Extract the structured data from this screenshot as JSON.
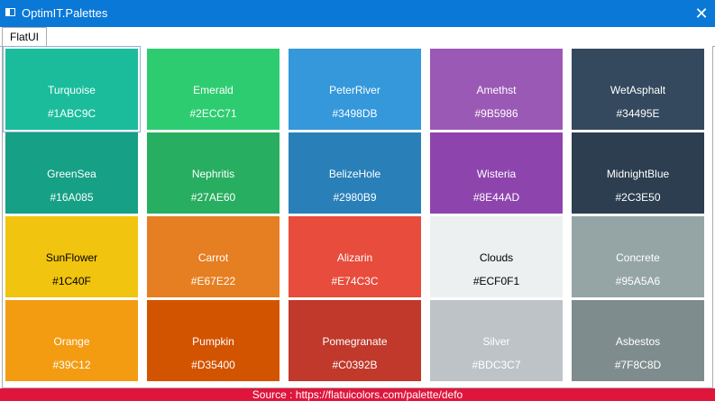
{
  "window": {
    "title": "OptimIT.Palettes",
    "close_glyph": "✕"
  },
  "tabs": [
    {
      "label": "FlatUI"
    }
  ],
  "palette": [
    {
      "name": "Turquoise",
      "hex": "#1ABC9C",
      "color": "#1abc9c",
      "text_color": "#ffffff"
    },
    {
      "name": "Emerald",
      "hex": "#2ECC71",
      "color": "#2ecc71",
      "text_color": "#ffffff"
    },
    {
      "name": "PeterRiver",
      "hex": "#3498DB",
      "color": "#3498db",
      "text_color": "#ffffff"
    },
    {
      "name": "Amethst",
      "hex": "#9B5986",
      "color": "#9b59b6",
      "text_color": "#ffffff"
    },
    {
      "name": "WetAsphalt",
      "hex": "#34495E",
      "color": "#34495e",
      "text_color": "#ffffff"
    },
    {
      "name": "GreenSea",
      "hex": "#16A085",
      "color": "#16a085",
      "text_color": "#ffffff"
    },
    {
      "name": "Nephritis",
      "hex": "#27AE60",
      "color": "#27ae60",
      "text_color": "#ffffff"
    },
    {
      "name": "BelizeHole",
      "hex": "#2980B9",
      "color": "#2980b9",
      "text_color": "#ffffff"
    },
    {
      "name": "Wisteria",
      "hex": "#8E44AD",
      "color": "#8e44ad",
      "text_color": "#ffffff"
    },
    {
      "name": "MidnightBlue",
      "hex": "#2C3E50",
      "color": "#2c3e50",
      "text_color": "#ffffff"
    },
    {
      "name": "SunFlower",
      "hex": "#1C40F",
      "color": "#f1c40f",
      "text_color": "#000000"
    },
    {
      "name": "Carrot",
      "hex": "#E67E22",
      "color": "#e67e22",
      "text_color": "#ffffff"
    },
    {
      "name": "Alizarin",
      "hex": "#E74C3C",
      "color": "#e74c3c",
      "text_color": "#ffffff"
    },
    {
      "name": "Clouds",
      "hex": "#ECF0F1",
      "color": "#ecf0f1",
      "text_color": "#000000"
    },
    {
      "name": "Concrete",
      "hex": "#95A5A6",
      "color": "#95a5a6",
      "text_color": "#ffffff"
    },
    {
      "name": "Orange",
      "hex": "#39C12",
      "color": "#f39c12",
      "text_color": "#ffffff"
    },
    {
      "name": "Pumpkin",
      "hex": "#D35400",
      "color": "#d35400",
      "text_color": "#ffffff"
    },
    {
      "name": "Pomegranate",
      "hex": "#C0392B",
      "color": "#c0392b",
      "text_color": "#ffffff"
    },
    {
      "name": "Silver",
      "hex": "#BDC3C7",
      "color": "#bdc3c7",
      "text_color": "#ffffff"
    },
    {
      "name": "Asbestos",
      "hex": "#7F8C8D",
      "color": "#7f8c8d",
      "text_color": "#ffffff"
    }
  ],
  "footer": {
    "text": "Source : https://flatuicolors.com/palette/defo",
    "color": "#e0153c"
  },
  "colors": {
    "titlebar": "#0a78d7"
  }
}
